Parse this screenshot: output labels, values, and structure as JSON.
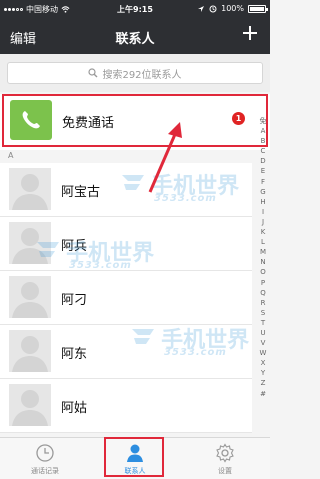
{
  "status_bar": {
    "carrier": "中国移动",
    "time": "上午9:15",
    "battery": "100%"
  },
  "nav": {
    "edit_label": "编辑",
    "title": "联系人",
    "add_icon": "plus-icon"
  },
  "search": {
    "placeholder": "搜索292位联系人",
    "icon": "search-icon"
  },
  "free_call": {
    "label": "免费通话",
    "badge": "1",
    "icon": "phone-icon",
    "icon_color": "#7cc24c"
  },
  "section": {
    "header": "A"
  },
  "contacts": [
    {
      "name": "阿宝古"
    },
    {
      "name": "阿兵"
    },
    {
      "name": "阿刁"
    },
    {
      "name": "阿东"
    },
    {
      "name": "阿姑"
    }
  ],
  "index_letters": [
    "免",
    "A",
    "B",
    "C",
    "D",
    "E",
    "F",
    "G",
    "H",
    "I",
    "J",
    "K",
    "L",
    "M",
    "N",
    "O",
    "P",
    "Q",
    "R",
    "S",
    "T",
    "U",
    "V",
    "W",
    "X",
    "Y",
    "Z",
    "#"
  ],
  "watermark": {
    "text": "手机世界",
    "sub": "3533.com"
  },
  "tabs": [
    {
      "label": "通话记录",
      "icon": "clock-icon"
    },
    {
      "label": "联系人",
      "icon": "person-icon"
    },
    {
      "label": "设置",
      "icon": "gear-icon"
    }
  ],
  "colors": {
    "header_bg": "#2d2f33",
    "accent": "#2d8ee0",
    "highlight": "#e0283a",
    "badge": "#e02323"
  }
}
